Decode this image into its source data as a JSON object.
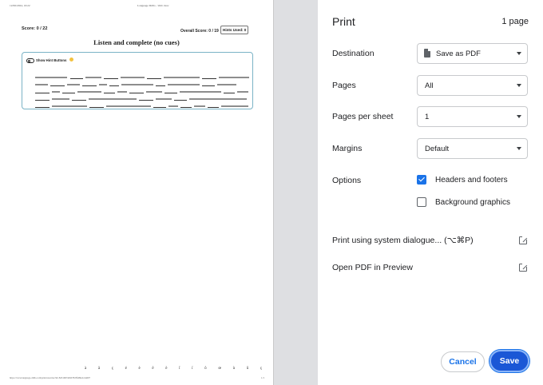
{
  "preview": {
    "header_date": "12/06/2024, 16:22",
    "header_title": "Language Drills - Web view",
    "score": "Score: 0 / 22",
    "overall_score": "Overall Score: 0 / 19",
    "hints_used": "Hints Used: 0",
    "heading": "Listen and complete (no cues)",
    "toggle_label": "Show Hint Buttons",
    "footer_chars": "à â ç é è ê ë î ï ô œ ù û ç",
    "footer_url": "https://www.language-drills.com/print/exercise?id=8451967a0b078c8fa89e2c4dd07",
    "footer_page_num": "1/1"
  },
  "panel": {
    "title": "Print",
    "page_count": "1 page",
    "destination_label": "Destination",
    "destination_value": "Save as PDF",
    "pages_label": "Pages",
    "pages_value": "All",
    "pps_label": "Pages per sheet",
    "pps_value": "1",
    "margins_label": "Margins",
    "margins_value": "Default",
    "options_label": "Options",
    "option_headers": "Headers and footers",
    "option_headers_checked": true,
    "option_background": "Background graphics",
    "option_background_checked": false,
    "system_dialogue": "Print using system dialogue... (⌥⌘P)",
    "open_pdf": "Open PDF in Preview",
    "cancel_label": "Cancel",
    "save_label": "Save"
  },
  "colors": {
    "accent": "#1a73e8",
    "save_button": "#1a57d6",
    "preview_bg": "#dedfe2",
    "card_border": "#7bb3c6"
  },
  "icons": [
    "document-icon",
    "chevron-down-icon",
    "checkbox-checked-icon",
    "checkbox-icon",
    "external-link-icon",
    "toggle-icon",
    "emoji-icon"
  ]
}
